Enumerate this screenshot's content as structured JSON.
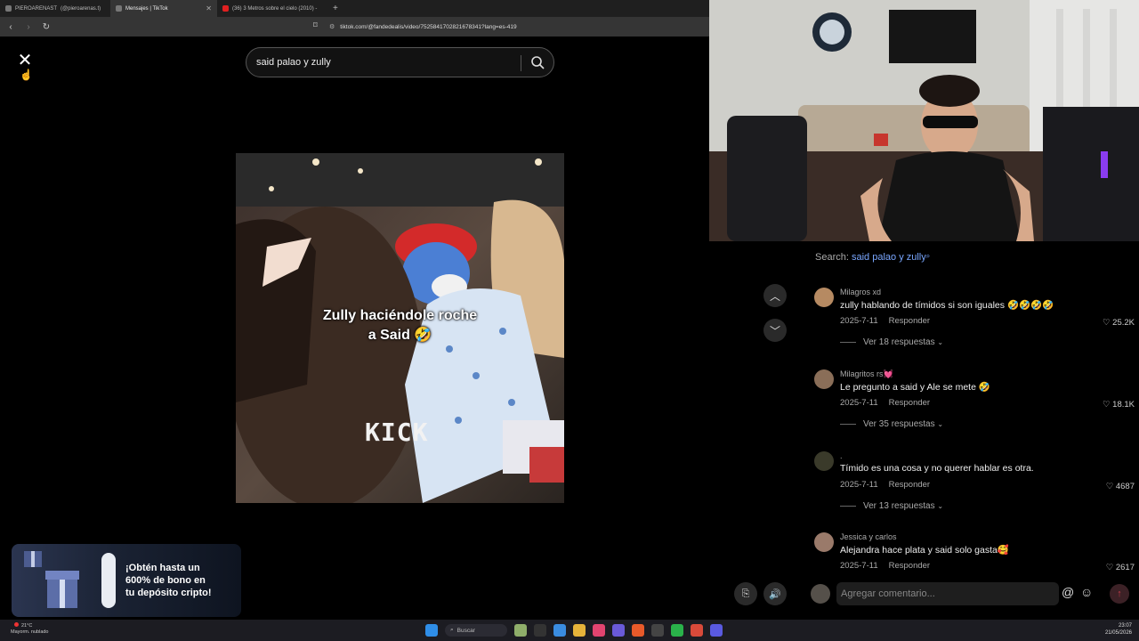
{
  "browser": {
    "tabs": [
      {
        "label": "PIEROARENAST",
        "extra": "(@pieroarenas.t)",
        "active": false
      },
      {
        "label": "Mensajes | TikTok",
        "extra": "",
        "active": true
      },
      {
        "label": "(36) 3 Metros sobre el cielo (2010) -",
        "extra": "",
        "active": false
      }
    ],
    "url": "tiktok.com/@fandedealis/video/7525841702821678341?lang=es-419"
  },
  "viewer": {
    "search_query": "said palao y zully",
    "caption_line1": "Zully haciéndole roche",
    "caption_line2": "a Said 🤣",
    "watermark": "KICK"
  },
  "promo": {
    "line1": "¡Obtén hasta un",
    "line2": "600% de bono en",
    "line3": "tu depósito cripto!"
  },
  "panel": {
    "search_prefix": "Search:",
    "search_term": "said palao y zully",
    "comments": [
      {
        "user": "Milagros xd",
        "text": "zully hablando de tímidos si son iguales 🤣🤣🤣🤣",
        "date": "2025-7-11",
        "reply": "Responder",
        "likes": "25.2K",
        "replies": "Ver 18 respuestas"
      },
      {
        "user": "Milagritos rs💓",
        "text": "Le pregunto a said y Ale se mete 🤣",
        "date": "2025-7-11",
        "reply": "Responder",
        "likes": "18.1K",
        "replies": "Ver 35 respuestas"
      },
      {
        "user": ".",
        "text": "Tímido es una cosa y no querer hablar es otra.",
        "date": "2025-7-11",
        "reply": "Responder",
        "likes": "4687",
        "replies": "Ver 13 respuestas"
      },
      {
        "user": "Jessica y carlos",
        "text": "Alejandra hace plata y said solo gasta🥰",
        "date": "2025-7-11",
        "reply": "Responder",
        "likes": "2617",
        "replies": ""
      }
    ],
    "comment_placeholder": "Agregar comentario..."
  },
  "taskbar": {
    "weather_temp": "21°C",
    "weather_desc": "Mayorm. nublado",
    "search_label": "Buscar",
    "time": "23:07",
    "date": "21/05/2026"
  },
  "colors": {
    "accent_link": "#7aa7ff",
    "send_button": "#c43b4c"
  }
}
